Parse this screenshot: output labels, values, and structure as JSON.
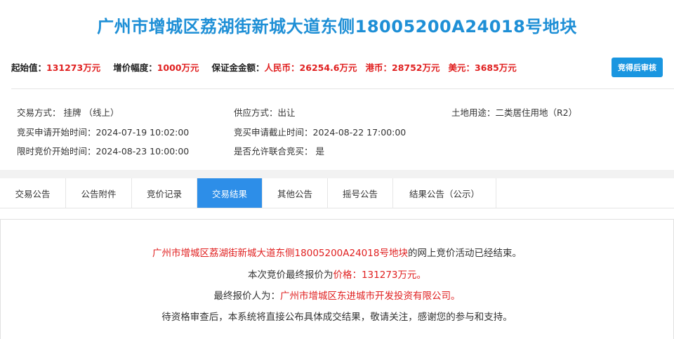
{
  "title": "广州市增城区荔湖街新城大道东侧18005200A24018号地块",
  "price_bar": {
    "start_label": "起始值：",
    "start_value": "131273万元",
    "step_label": "增价幅度：",
    "step_value": "1000万元",
    "deposit_label": "保证金金额：",
    "rmb_label": "人民币：",
    "rmb_value": "26254.6万元",
    "hkd_label": "港币：",
    "hkd_value": "28752万元",
    "usd_label": "美元：",
    "usd_value": "3685万元"
  },
  "action_button": "竞得后审核",
  "info": {
    "trade_mode": "交易方式： 挂牌 （线上）",
    "supply_mode": "供应方式：出让",
    "land_use": "土地用途：二类居住用地（R2）",
    "apply_start": "竞买申请开始时间：2024-07-19 10:02:00",
    "apply_end": "竞买申请截止时间：2024-08-22 17:00:00",
    "bid_start": "限时竞价开始时间：2024-08-23 10:00:00",
    "joint_bid": "是否允许联合竞买： 是"
  },
  "tabs": [
    {
      "label": "交易公告",
      "active": false
    },
    {
      "label": "公告附件",
      "active": false
    },
    {
      "label": "竞价记录",
      "active": false
    },
    {
      "label": "交易结果",
      "active": true
    },
    {
      "label": "其他公告",
      "active": false
    },
    {
      "label": "摇号公告",
      "active": false
    },
    {
      "label": "结果公告（公示）",
      "active": false
    }
  ],
  "result": {
    "line1_red": "广州市增城区荔湖街新城大道东侧18005200A24018号地块",
    "line1_rest": "的网上竞价活动已经结束。",
    "line2_prefix": "本次竞价最终报价为",
    "line2_red": "价格：131273万元。",
    "line3_prefix": "最终报价人为：",
    "line3_red": "广州市增城区东进城市开发投资有限公司。",
    "line4": "待资格审查后，本系统将直接公布具体成交结果，敬请关注，感谢您的参与和支持。"
  },
  "colors": {
    "title": "#1e8fd6",
    "accent": "#2d8ee8",
    "highlight": "#e02020"
  }
}
